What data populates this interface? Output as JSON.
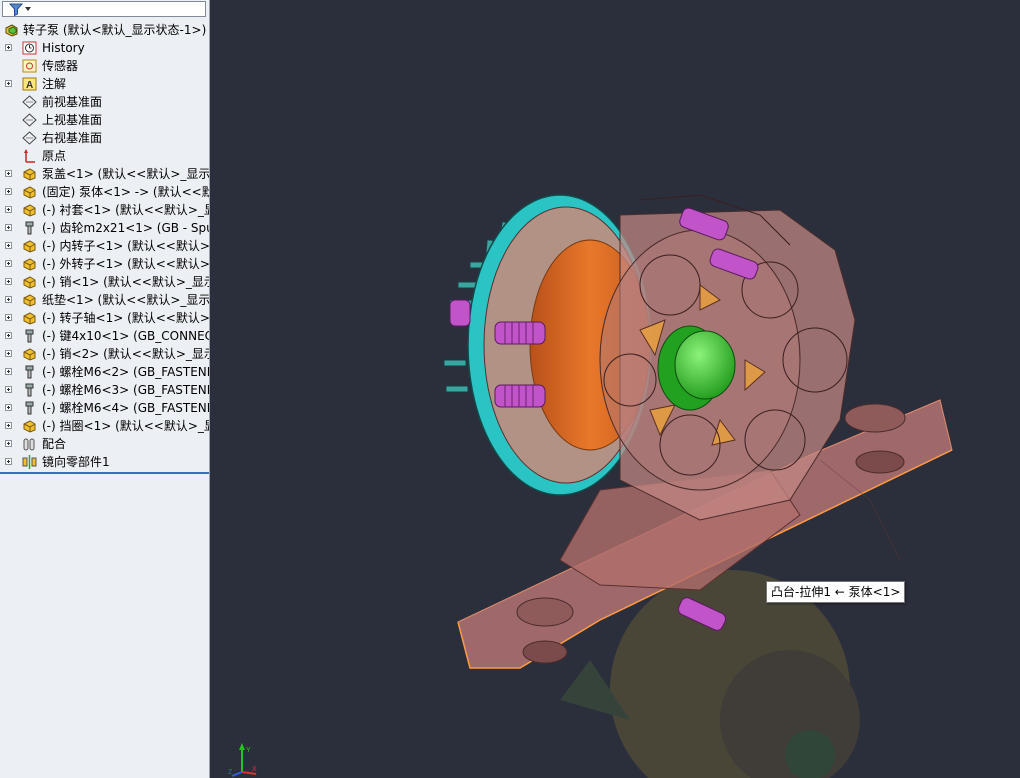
{
  "tree": {
    "root_label": "转子泵  (默认<默认_显示状态-1>)",
    "items": [
      {
        "label": "History",
        "icon": "history-icon",
        "expandable": true
      },
      {
        "label": "传感器",
        "icon": "sensor-icon",
        "expandable": false
      },
      {
        "label": "注解",
        "icon": "annotation-icon",
        "expandable": true
      },
      {
        "label": "前视基准面",
        "icon": "plane-icon",
        "expandable": false
      },
      {
        "label": "上视基准面",
        "icon": "plane-icon",
        "expandable": false
      },
      {
        "label": "右视基准面",
        "icon": "plane-icon",
        "expandable": false
      },
      {
        "label": "原点",
        "icon": "origin-icon",
        "expandable": false
      },
      {
        "label": "泵盖<1> (默认<<默认>_显示状",
        "icon": "part-icon",
        "expandable": true
      },
      {
        "label": "(固定) 泵体<1> -> (默认<<默认",
        "icon": "part-icon",
        "expandable": true
      },
      {
        "label": "(-) 衬套<1> (默认<<默认>_显",
        "icon": "part-icon",
        "expandable": true
      },
      {
        "label": "(-) 齿轮m2x21<1> (GB - Spu",
        "icon": "toolbox-part-icon",
        "expandable": true
      },
      {
        "label": "(-) 内转子<1> (默认<<默认>_",
        "icon": "part-icon",
        "expandable": true
      },
      {
        "label": "(-) 外转子<1> (默认<<默认>_",
        "icon": "part-icon",
        "expandable": true
      },
      {
        "label": "(-) 销<1> (默认<<默认>_显示",
        "icon": "part-icon",
        "expandable": true
      },
      {
        "label": "纸垫<1> (默认<<默认>_显示状",
        "icon": "part-icon",
        "expandable": true
      },
      {
        "label": "(-) 转子轴<1> (默认<<默认>_",
        "icon": "part-icon",
        "expandable": true
      },
      {
        "label": "(-) 键4x10<1> (GB_CONNECT",
        "icon": "toolbox-part-icon",
        "expandable": true
      },
      {
        "label": "(-) 销<2> (默认<<默认>_显示",
        "icon": "part-icon",
        "expandable": true
      },
      {
        "label": "(-) 螺栓M6<2> (GB_FASTENE",
        "icon": "toolbox-part-icon",
        "expandable": true
      },
      {
        "label": "(-) 螺栓M6<3> (GB_FASTENE",
        "icon": "toolbox-part-icon",
        "expandable": true
      },
      {
        "label": "(-) 螺栓M6<4> (GB_FASTENE",
        "icon": "toolbox-part-icon",
        "expandable": true
      },
      {
        "label": "(-) 挡圈<1> (默认<<默认>_显",
        "icon": "part-icon",
        "expandable": true
      },
      {
        "label": "配合",
        "icon": "mates-icon",
        "expandable": true
      },
      {
        "label": "镜向零部件1",
        "icon": "mirror-icon",
        "expandable": true
      }
    ]
  },
  "viewport": {
    "tooltip": "凸台-拉伸1 ← 泵体<1>",
    "background": "#2b2f3b"
  },
  "triad": {
    "x_label": "X",
    "y_label": "Y",
    "z_label": "Z"
  }
}
